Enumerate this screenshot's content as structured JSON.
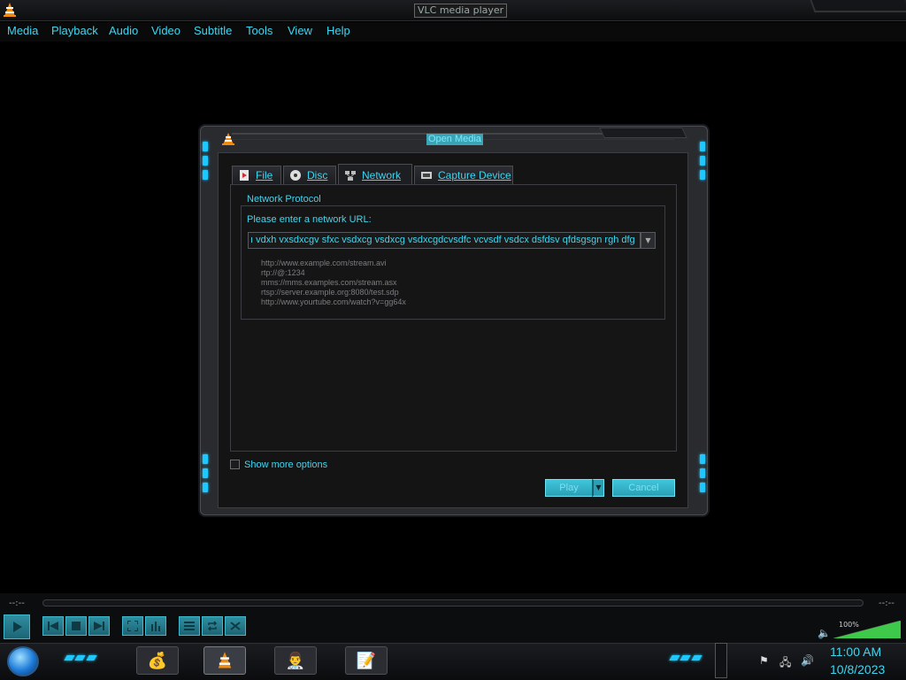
{
  "window": {
    "title": "VLC media player"
  },
  "menubar": {
    "items": [
      "Media",
      "Playback",
      "Audio",
      "Video",
      "Subtitle",
      "Tools",
      "View",
      "Help"
    ]
  },
  "dialog": {
    "title": "Open Media",
    "tabs": [
      {
        "label": "File",
        "icon": "file-icon"
      },
      {
        "label": "Disc",
        "icon": "disc-icon"
      },
      {
        "label": "Network",
        "icon": "network-icon",
        "active": true
      },
      {
        "label": "Capture Device",
        "icon": "capture-device-icon"
      }
    ],
    "group_title": "Network Protocol",
    "url_label": "Please enter a network URL:",
    "url_value": "ı vdxh vxsdxcgv sfxc vsdxcg vsdxcg vsdxcgdcvsdfc vcvsdf vsdcx dsfdsv qfdsgsgn rgh dfg",
    "examples": [
      "http://www.example.com/stream.avi",
      "rtp://@:1234",
      "mms://mms.examples.com/stream.asx",
      "rtsp://server.example.org:8080/test.sdp",
      "http://www.yourtube.com/watch?v=gg64x"
    ],
    "show_more_options": "Show more options",
    "show_more_checked": false,
    "play_label": "Play",
    "cancel_label": "Cancel"
  },
  "controls": {
    "elapsed": "--:--",
    "remaining": "--:--",
    "volume_percent": "100%",
    "volume_level": 1.0
  },
  "taskbar": {
    "apps": [
      "money-bag-icon",
      "vlc-cone-icon",
      "user-icon",
      "notepad-icon"
    ],
    "clock_time": "11:00 AM",
    "clock_date": "10/8/2023"
  },
  "colors": {
    "accent": "#3fd6f0",
    "led": "#1ec8ff",
    "button": "#2aa0b5",
    "background": "#000000",
    "dialog": "#141414"
  }
}
